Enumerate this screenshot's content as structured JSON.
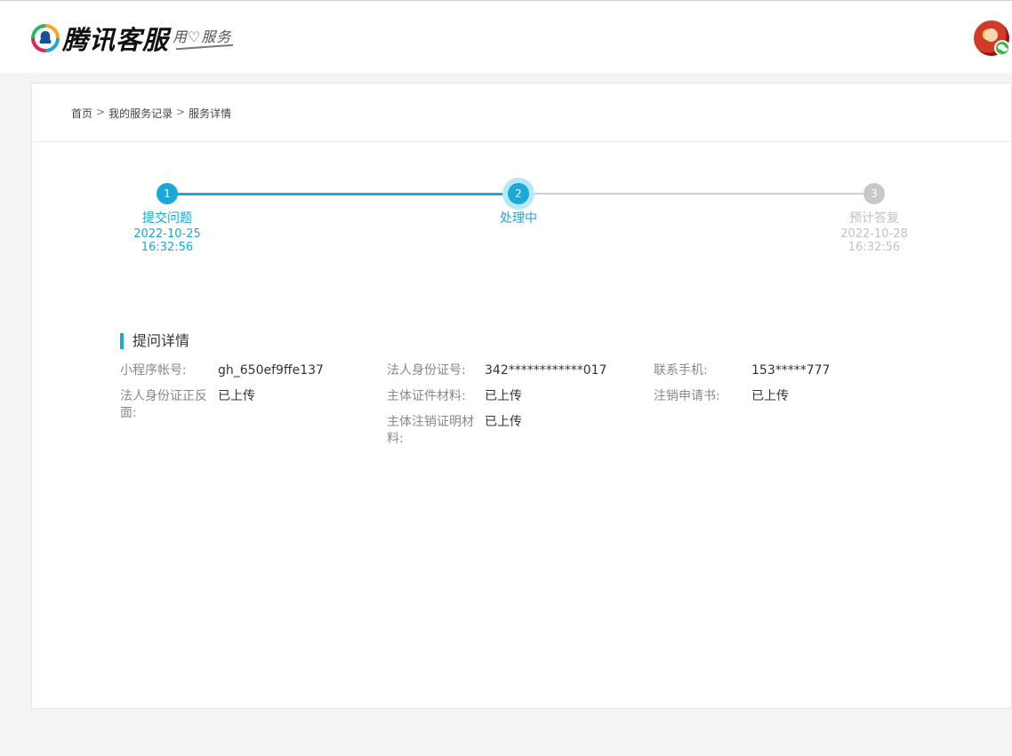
{
  "header": {
    "logo_text": "腾讯客服",
    "slogan": "用♡服务"
  },
  "breadcrumb": [
    "首页",
    "我的服务记录",
    "服务详情"
  ],
  "breadcrumb_separator": ">",
  "steps": [
    {
      "number": "1",
      "title": "提交问题",
      "date": "2022-10-25",
      "time": "16:32:56",
      "status": "done"
    },
    {
      "number": "2",
      "title": "处理中",
      "date": "",
      "time": "",
      "status": "active"
    },
    {
      "number": "3",
      "title": "预计答复",
      "date": "2022-10-28",
      "time": "16:32:56",
      "status": "pending"
    }
  ],
  "section_title": "提问详情",
  "details": [
    {
      "label": "小程序帐号:",
      "value": "gh_650ef9ffe137"
    },
    {
      "label": "法人身份证号:",
      "value": "342************017"
    },
    {
      "label": "联系手机:",
      "value": "153*****777"
    },
    {
      "label": "法人身份证正反面:",
      "value": "已上传"
    },
    {
      "label": "主体证件材料:",
      "value": "已上传"
    },
    {
      "label": "注销申请书:",
      "value": "已上传"
    },
    {
      "label": "主体注销证明材料:",
      "value": "已上传"
    }
  ],
  "colors": {
    "accent": "#1aa7d9",
    "inactive": "#c8c8c8"
  }
}
